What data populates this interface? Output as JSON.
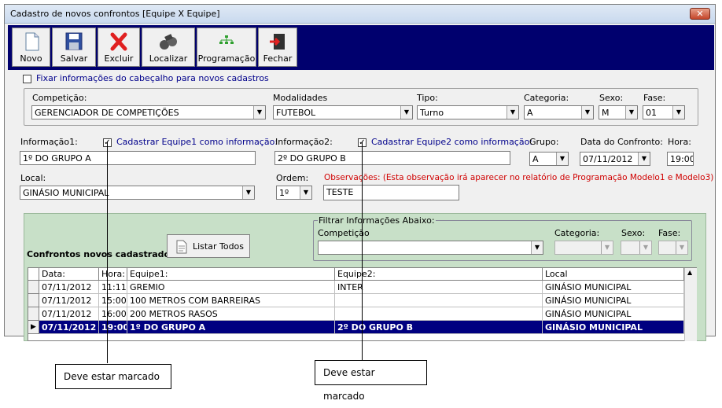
{
  "window": {
    "title": "Cadastro de novos confrontos [Equipe X Equipe]",
    "close": "✕"
  },
  "toolbar": {
    "novo": "Novo",
    "salvar": "Salvar",
    "excluir": "Excluir",
    "localizar": "Localizar",
    "programacao": "Programação",
    "fechar": "Fechar"
  },
  "fixar": {
    "label": "Fixar informações do cabeçalho para novos cadastros",
    "checked": false
  },
  "header": {
    "competicao": {
      "label": "Competição:",
      "value": "GERENCIADOR DE COMPETIÇÕES"
    },
    "modalidades": {
      "label": "Modalidades",
      "value": "FUTEBOL"
    },
    "tipo": {
      "label": "Tipo:",
      "value": "Turno"
    },
    "categoria": {
      "label": "Categoria:",
      "value": "A"
    },
    "sexo": {
      "label": "Sexo:",
      "value": "M"
    },
    "fase": {
      "label": "Fase:",
      "value": "01"
    }
  },
  "form": {
    "info1": {
      "label": "Informação1:",
      "value": "1º DO GRUPO A",
      "check_label": "Cadastrar Equipe1 como informação:",
      "checked": true
    },
    "info2": {
      "label": "Informação2:",
      "value": "2º DO GRUPO B",
      "check_label": "Cadastrar Equipe2 como informação:",
      "checked": true
    },
    "grupo": {
      "label": "Grupo:",
      "value": "A"
    },
    "data": {
      "label": "Data do Confronto:",
      "value": "07/11/2012"
    },
    "hora": {
      "label": "Hora:",
      "value": "19:00"
    },
    "local": {
      "label": "Local:",
      "value": "GINÁSIO MUNICIPAL"
    },
    "ordem": {
      "label": "Ordem:",
      "value": "1º"
    },
    "obs": {
      "label": "Observações: (Esta observação irá aparecer no relatório de Programação Modelo1 e Modelo3)",
      "value": "TESTE"
    }
  },
  "list": {
    "title": "Confrontos novos cadastrados:",
    "listar_todos": "Listar Todos",
    "filter": {
      "legend": "Filtrar Informações Abaixo:",
      "competicao": "Competição",
      "categoria": "Categoria:",
      "sexo": "Sexo:",
      "fase": "Fase:"
    },
    "columns": [
      "Data:",
      "Hora:",
      "Equipe1:",
      "Equipe2:",
      "Local"
    ],
    "rows": [
      [
        "07/11/2012",
        "11:11",
        "GREMIO",
        "INTER",
        "GINÁSIO MUNICIPAL"
      ],
      [
        "07/11/2012",
        "15:00",
        "100 METROS COM BARREIRAS",
        "",
        "GINÁSIO MUNICIPAL"
      ],
      [
        "07/11/2012",
        "16:00",
        "200 METROS RASOS",
        "",
        "GINÁSIO MUNICIPAL"
      ],
      [
        "07/11/2012",
        "19:00",
        "1º DO GRUPO A",
        "2º DO GRUPO B",
        "GINÁSIO MUNICIPAL"
      ]
    ],
    "selected_row": 3
  },
  "callouts": {
    "left": "Deve estar marcado",
    "right": "Deve estar marcado"
  }
}
